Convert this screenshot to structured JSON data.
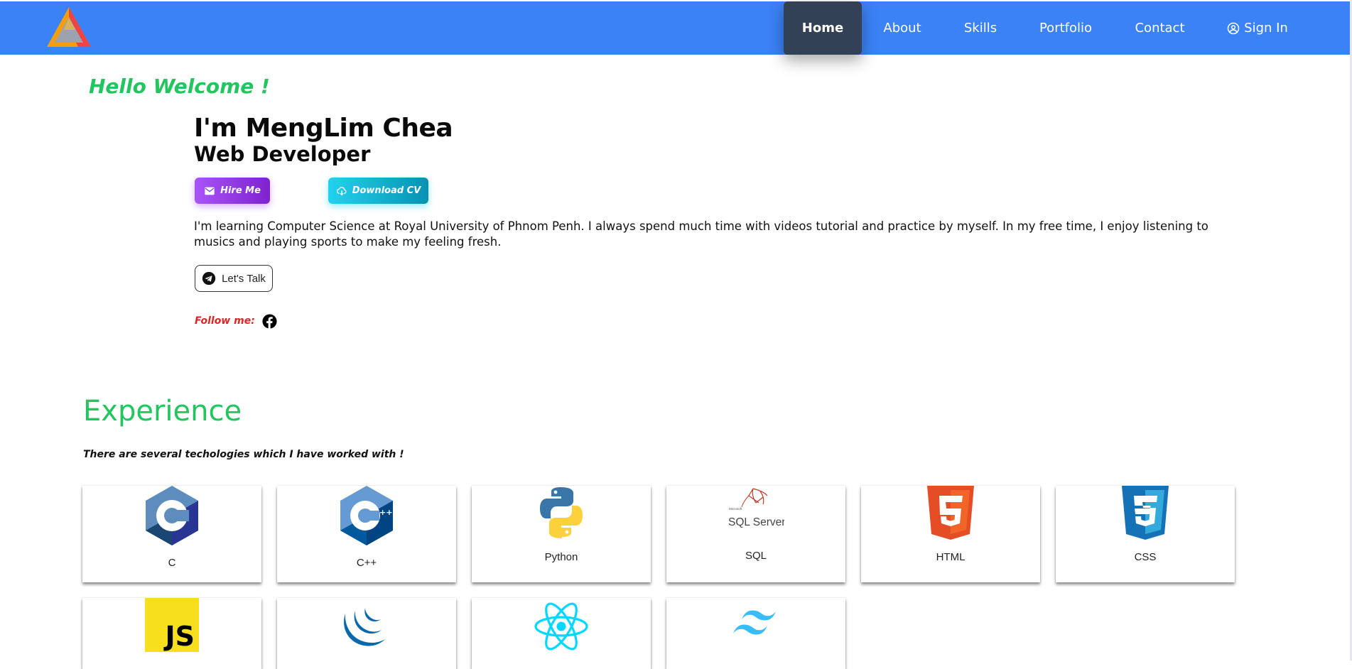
{
  "nav": {
    "items": [
      "Home",
      "About",
      "Skills",
      "Portfolio",
      "Contact"
    ],
    "active": "Home",
    "signin_label": "Sign In",
    "colors": {
      "bar": "#3b82f6",
      "active": "#334155"
    }
  },
  "hero": {
    "welcome": "Hello Welcome !",
    "name": "I'm MengLim Chea",
    "role": "Web Developer",
    "hire_label": "Hire Me",
    "cv_label": "Download CV",
    "bio": "I'm learning Computer Science at Royal University of Phnom Penh. I always spend much time with videos tutorial and practice by myself. In my free time, I enjoy listening to musics and playing sports to make my feeling fresh.",
    "talk_label": "Let's Talk",
    "follow_label": "Follow me:"
  },
  "experience": {
    "title": "Experience",
    "subtitle": "There are several techologies which I have worked with !",
    "cards": [
      {
        "label": "C",
        "icon": "c-icon"
      },
      {
        "label": "C++",
        "icon": "cpp-icon"
      },
      {
        "label": "Python",
        "icon": "python-icon"
      },
      {
        "label": "SQL",
        "icon": "sql-server-icon",
        "logo_text": "SQL Server",
        "logo_small": "Microsoft"
      },
      {
        "label": "HTML",
        "icon": "html5-icon"
      },
      {
        "label": "CSS",
        "icon": "css3-icon"
      },
      {
        "label": "",
        "icon": "javascript-icon",
        "logo_text": "JS"
      },
      {
        "label": "",
        "icon": "jquery-icon"
      },
      {
        "label": "",
        "icon": "react-icon"
      },
      {
        "label": "",
        "icon": "tailwind-icon"
      }
    ]
  },
  "colors": {
    "accent_green": "#22c55e",
    "follow_red": "#dc2626",
    "hire_purple": "#a855f7",
    "cv_cyan": "#22d3ee"
  }
}
